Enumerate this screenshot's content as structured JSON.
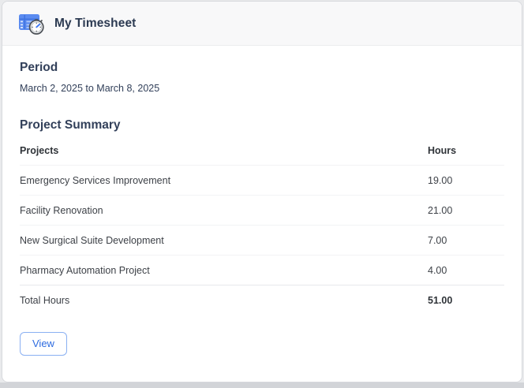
{
  "header": {
    "title": "My Timesheet",
    "icon": "timesheet-clock-icon"
  },
  "period": {
    "label": "Period",
    "value": "March 2, 2025 to March 8, 2025"
  },
  "summary": {
    "title": "Project Summary",
    "columns": {
      "project": "Projects",
      "hours": "Hours"
    },
    "rows": [
      {
        "project": "Emergency Services Improvement",
        "hours": "19.00"
      },
      {
        "project": "Facility Renovation",
        "hours": "21.00"
      },
      {
        "project": "New Surgical Suite Development",
        "hours": "7.00"
      },
      {
        "project": "Pharmacy Automation Project",
        "hours": "4.00"
      }
    ],
    "total": {
      "label": "Total Hours",
      "hours": "51.00"
    }
  },
  "actions": {
    "view_label": "View"
  },
  "colors": {
    "accent_blue": "#2d6be0",
    "button_border": "#8ab0f2",
    "heading_navy": "#32405a",
    "icon_table_blue": "#5b8bf0",
    "icon_table_light": "#aec7f8",
    "clock_ring_gray": "#4a4f55",
    "header_bg": "#f8f8f9",
    "card_border": "#d7d9dd",
    "page_bg": "#e9eaec",
    "bottom_strip": "#d2d4d8"
  }
}
